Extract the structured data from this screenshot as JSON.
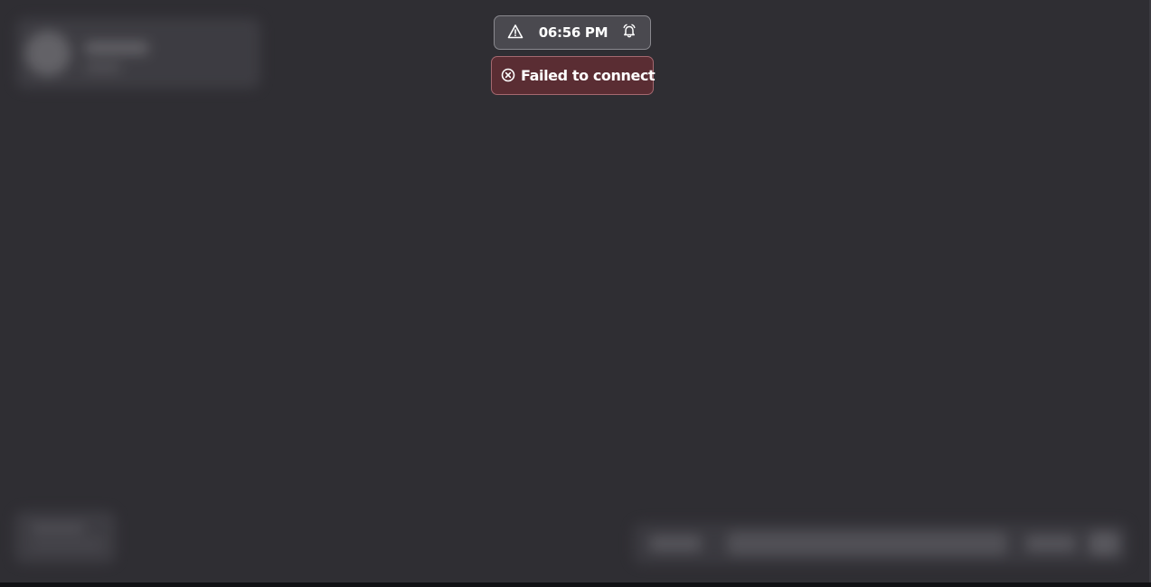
{
  "status_bar": {
    "time": "06:56 PM",
    "left_icon": "warning-triangle-icon",
    "right_icon": "alarm-clock-icon"
  },
  "error_toast": {
    "message": "Failed to connect",
    "icon": "error-circle-x-icon",
    "background_color": "#5a2d33",
    "border_color": "#a46870"
  },
  "theme": {
    "background_color": "#2f2e33",
    "pill_background_color": "#4a494f"
  }
}
